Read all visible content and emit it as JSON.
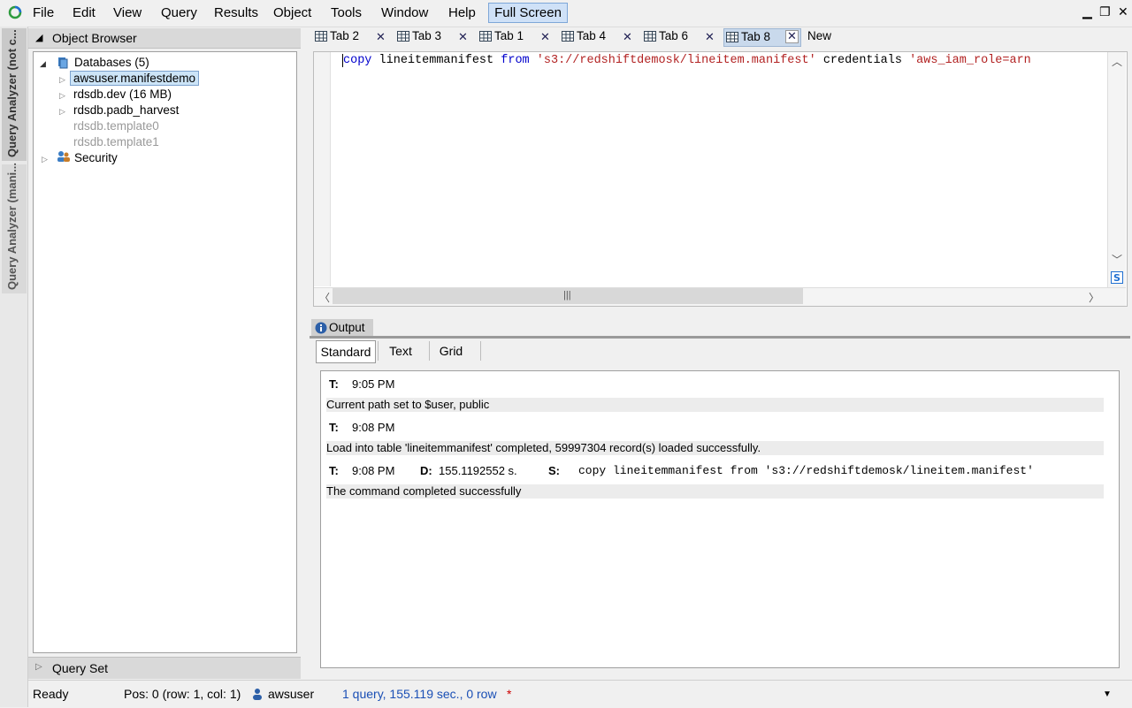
{
  "menu": {
    "items": [
      "File",
      "Edit",
      "View",
      "Query",
      "Results",
      "Object",
      "Tools",
      "Window",
      "Help"
    ],
    "fullscreen_label": "Full Screen"
  },
  "side_tabs": [
    "Query Analyzer (not c...",
    "Query Analyzer (mani..."
  ],
  "object_browser": {
    "title": "Object Browser",
    "databases_label": "Databases (5)",
    "databases": [
      {
        "name": "awsuser.manifestdemo",
        "selected": true
      },
      {
        "name": "rdsdb.dev (16 MB)"
      },
      {
        "name": "rdsdb.padb_harvest"
      },
      {
        "name": "rdsdb.template0",
        "disabled": true
      },
      {
        "name": "rdsdb.template1",
        "disabled": true
      }
    ],
    "security_label": "Security"
  },
  "query_set": {
    "title": "Query Set"
  },
  "tabs": [
    "Tab 2",
    "Tab 3",
    "Tab 1",
    "Tab 4",
    "Tab 6",
    "Tab 8"
  ],
  "new_tab_label": "New",
  "editor": {
    "kw_copy": "copy",
    "table": "lineitemmanifest",
    "kw_from": "from",
    "path": "'s3://redshiftdemosk/lineitem.manifest'",
    "word_credentials": "credentials",
    "role": "'aws_iam_role=arn"
  },
  "output": {
    "tab_label": "Output",
    "subtabs": [
      "Standard",
      "Text",
      "Grid"
    ],
    "entries": [
      {
        "t_label": "T:",
        "time": "9:05 PM"
      },
      {
        "message": "Current path set to $user, public"
      },
      {
        "t_label": "T:",
        "time": "9:08 PM"
      },
      {
        "message": "Load into table 'lineitemmanifest' completed, 59997304 record(s) loaded successfully."
      },
      {
        "t_label": "T:",
        "time": "9:08 PM",
        "d_label": "D:",
        "duration": "155.1192552 s.",
        "s_label": "S:",
        "statement": "copy lineitemmanifest from 's3://redshiftdemosk/lineitem.manifest'"
      },
      {
        "message": "The command completed successfully"
      }
    ]
  },
  "status": {
    "ready": "Ready",
    "position": "Pos: 0 (row: 1, col: 1)",
    "user": "awsuser",
    "summary": "1 query, 155.119 sec., 0 row",
    "modified_marker": "*"
  },
  "colors": {
    "accent": "#1a4fb5",
    "keyword": "#0000cc",
    "string": "#b22222",
    "selection": "#cce4f7"
  }
}
